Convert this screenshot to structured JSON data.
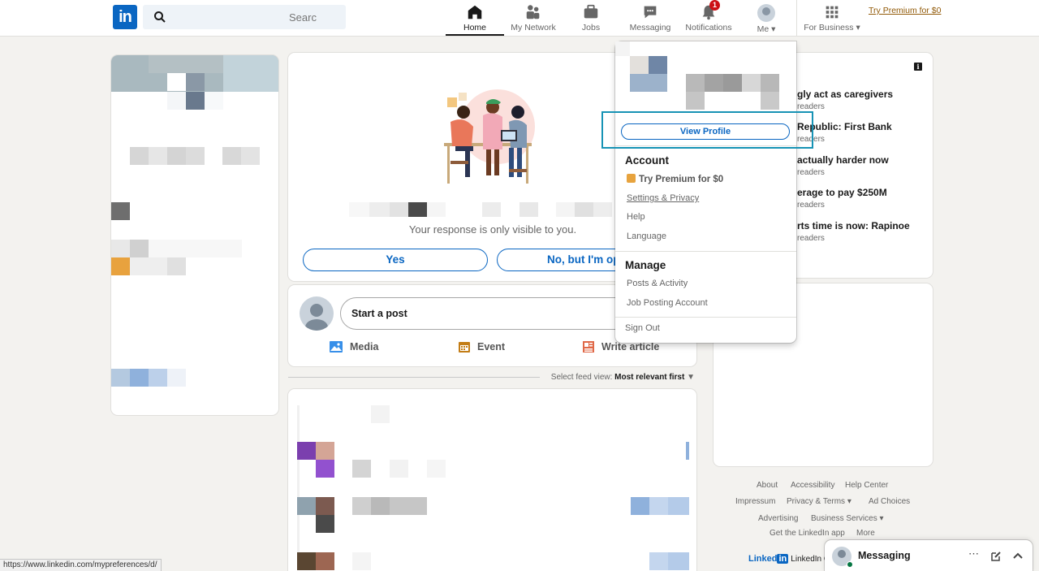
{
  "nav": {
    "search_placeholder": "Search",
    "items": [
      {
        "label": "Home",
        "icon": "home-icon",
        "active": true
      },
      {
        "label": "My Network",
        "icon": "network-icon"
      },
      {
        "label": "Jobs",
        "icon": "briefcase-icon"
      },
      {
        "label": "Messaging",
        "icon": "messaging-icon"
      },
      {
        "label": "Notifications",
        "icon": "bell-icon",
        "badge": "1"
      },
      {
        "label": "Me",
        "icon": "avatar"
      },
      {
        "label": "For Business",
        "icon": "grid-icon"
      }
    ],
    "premium_link": "Try Premium for $0"
  },
  "poll": {
    "response_note": "Your response is only visible to you.",
    "yes_label": "Yes",
    "no_label": "No, but I'm op"
  },
  "composer": {
    "placeholder": "Start a post",
    "actions": [
      {
        "label": "Media",
        "icon": "image-icon",
        "color": "#378fe9"
      },
      {
        "label": "Event",
        "icon": "calendar-icon",
        "color": "#c37d16"
      },
      {
        "label": "Write article",
        "icon": "article-icon",
        "color": "#e06847"
      }
    ]
  },
  "feed_sort": {
    "prefix": "Select feed view:",
    "value": "Most relevant first"
  },
  "me_menu": {
    "view_profile": "View Profile",
    "account_heading": "Account",
    "account_items": [
      "Try Premium for $0",
      "Settings & Privacy",
      "Help",
      "Language"
    ],
    "manage_heading": "Manage",
    "manage_items": [
      "Posts & Activity",
      "Job Posting Account"
    ],
    "sign_out": "Sign Out"
  },
  "news": [
    {
      "title": "gly act as caregivers",
      "sub": "readers"
    },
    {
      "title": "Republic: First Bank",
      "sub": "readers"
    },
    {
      "title": "actually harder now",
      "sub": "readers"
    },
    {
      "title": "erage to pay $250M",
      "sub": "readers"
    },
    {
      "title": "rts time is now: Rapinoe",
      "sub": "readers"
    }
  ],
  "footer": {
    "row1": [
      "About",
      "Accessibility",
      "Help Center"
    ],
    "row2": [
      "Impressum",
      "Privacy & Terms",
      "Ad Choices"
    ],
    "row3": [
      "Advertising",
      "Business Services"
    ],
    "row4": [
      "Get the LinkedIn app",
      "More"
    ],
    "brand_a": "Linked",
    "brand_b": "in",
    "brand_tail": "LinkedIn C"
  },
  "messaging_bar": {
    "label": "Messaging"
  },
  "status_url": "https://www.linkedin.com/mypreferences/d/",
  "colors": {
    "brand": "#0a66c2",
    "highlight": "#1793b5",
    "badge": "#cc1016"
  }
}
